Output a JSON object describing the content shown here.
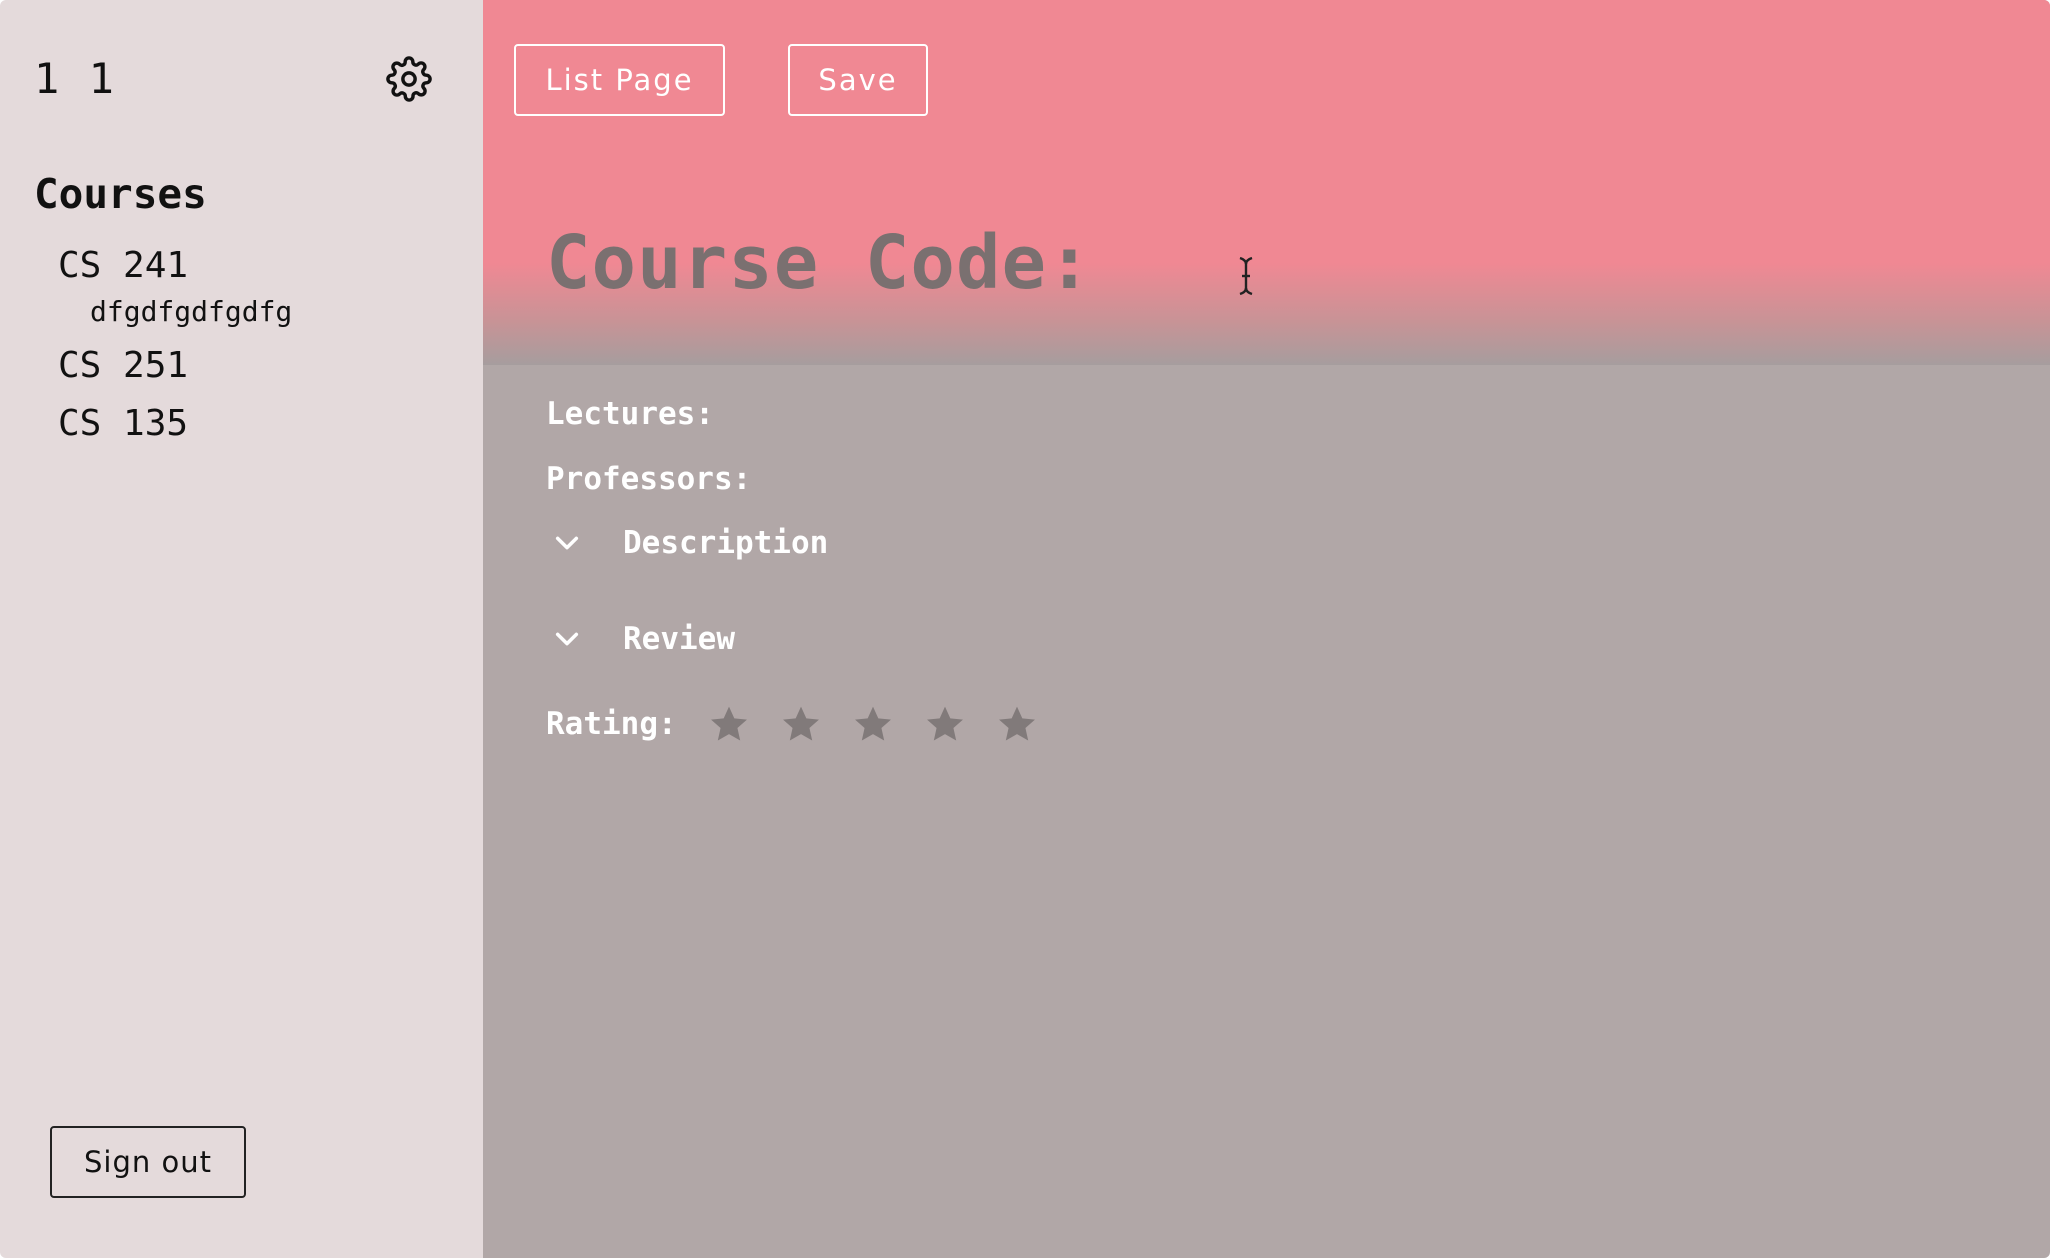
{
  "sidebar": {
    "user_name": "1 1",
    "courses_heading": "Courses",
    "courses": [
      {
        "code": "CS 241",
        "sub": "dfgdfgdfgdfg"
      },
      {
        "code": "CS 251"
      },
      {
        "code": "CS 135"
      }
    ],
    "sign_out_label": "Sign out",
    "settings_icon": "gear-icon"
  },
  "toolbar": {
    "list_page_label": "List Page",
    "save_label": "Save"
  },
  "course": {
    "code_label": "Course Code:",
    "lectures_label": "Lectures:",
    "professors_label": "Professors:",
    "description_label": "Description",
    "review_label": "Review",
    "rating_label": "Rating:",
    "rating_value": 0,
    "rating_max": 5
  },
  "colors": {
    "header_accent": "#f08893",
    "main_background": "#b1a7a7",
    "sidebar_background": "#e4dadb",
    "star_color": "#817a7a"
  }
}
